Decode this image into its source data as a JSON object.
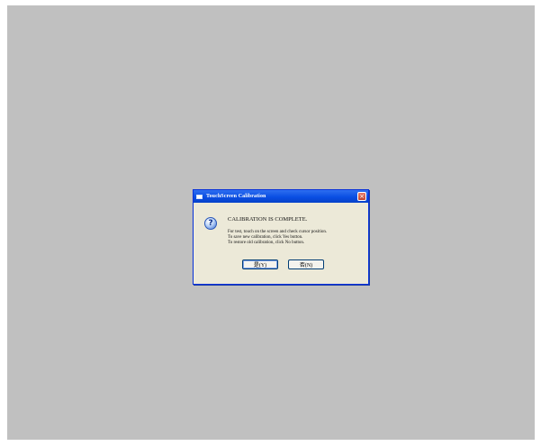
{
  "dialog": {
    "title": "TouchScreen Calibration",
    "close_glyph": "×",
    "icon": "question-icon",
    "icon_glyph": "?",
    "heading": "CALIBRATION IS COMPLETE.",
    "lines": [
      "For test, touch on the screen and check cursor position.",
      "To save new calibration, click Yes button.",
      "To restore old calibration, click No button."
    ],
    "yes_label": "是(Y)",
    "no_label": "否(N)"
  },
  "colors": {
    "desktop": "#c0c0c0",
    "dialog_bg": "#ece9d8",
    "titlebar": "#0a4ee3"
  }
}
